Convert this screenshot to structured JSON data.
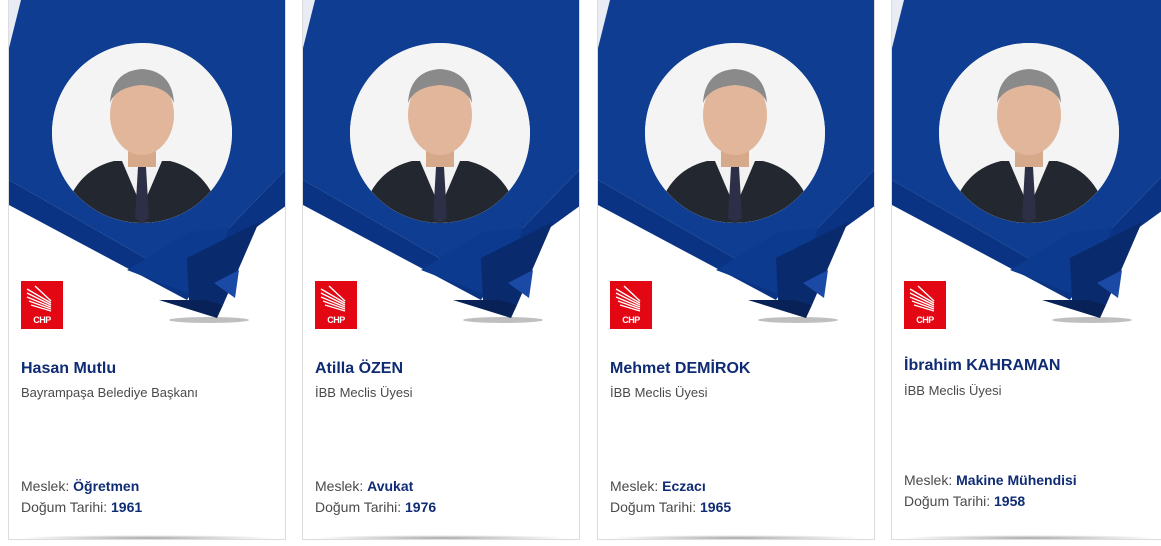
{
  "colors": {
    "brand_blue": "#0f3d91",
    "brand_blue_dark": "#0a2a6e",
    "brand_red": "#e30613",
    "name_color": "#0f2b73"
  },
  "labels": {
    "profession": "Meslek:",
    "birth_date": "Doğum Tarihi:"
  },
  "party_logo": {
    "text": "CHP",
    "icon": "chp-six-arrows-logo"
  },
  "members": [
    {
      "name": "Hasan Mutlu",
      "title": "Bayrampaşa Belediye Başkanı",
      "profession": "Öğretmen",
      "birth_year": "1961",
      "photo_icon": "portrait-photo"
    },
    {
      "name": "Atilla ÖZEN",
      "title": "İBB Meclis Üyesi",
      "profession": "Avukat",
      "birth_year": "1976",
      "photo_icon": "portrait-photo"
    },
    {
      "name": "Mehmet DEMİROK",
      "title": "İBB Meclis Üyesi",
      "profession": "Eczacı",
      "birth_year": "1965",
      "photo_icon": "portrait-photo"
    },
    {
      "name": "İbrahim KAHRAMAN",
      "title": "İBB Meclis Üyesi",
      "profession": "Makine Mühendisi",
      "birth_year": "1958",
      "photo_icon": "portrait-photo"
    }
  ]
}
